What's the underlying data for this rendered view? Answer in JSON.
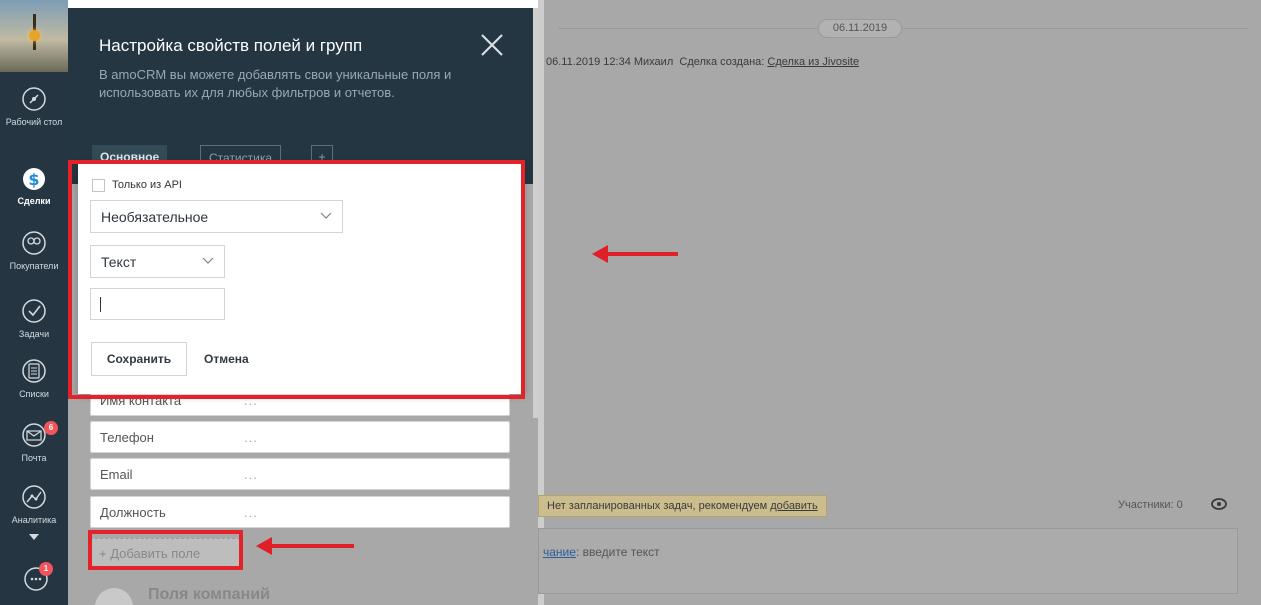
{
  "nav": {
    "items": [
      {
        "label": "Рабочий стол",
        "icon": "dashboard-icon"
      },
      {
        "label": "Сделки",
        "icon": "deals-icon"
      },
      {
        "label": "Покупатели",
        "icon": "customers-icon"
      },
      {
        "label": "Задачи",
        "icon": "tasks-icon"
      },
      {
        "label": "Списки",
        "icon": "lists-icon"
      },
      {
        "label": "Почта",
        "icon": "mail-icon",
        "badge": "6"
      },
      {
        "label": "Аналитика",
        "icon": "analytics-icon"
      }
    ],
    "chat_badge": "1",
    "active_color": "#ffffff",
    "accent": "#f2545b"
  },
  "panel": {
    "title": "Настройка свойств полей и групп",
    "subtitle": "В amoCRM вы можете добавлять свои уникальные поля и использовать их для любых фильтров и отчетов.",
    "tabs": [
      {
        "label": "Основное"
      },
      {
        "label": "Статистика"
      },
      {
        "label": "+"
      }
    ],
    "fields": [
      {
        "name": "Имя контакта",
        "value": "..."
      },
      {
        "name": "Телефон",
        "value": "..."
      },
      {
        "name": "Email",
        "value": "..."
      },
      {
        "name": "Должность",
        "value": "..."
      }
    ],
    "add_field_label": "+ Добавить поле",
    "company_section": "Поля компаний"
  },
  "popup": {
    "api_only_label": "Только из API",
    "requirement_select": "Необязательное",
    "type_select": "Текст",
    "name_input_value": "",
    "save_label": "Сохранить",
    "cancel_label": "Отмена",
    "highlight_color": "#e3222a"
  },
  "feed": {
    "date_pill": "06.11.2019",
    "event_meta": "06.11.2019 12:34 Михаил",
    "event_text": "Сделка создана:",
    "event_link": "Сделка из Jivosite",
    "no_tasks_text": "Нет запланированных задач, рекомендуем",
    "no_tasks_link": "добавить",
    "participants": "Участники: 0",
    "note_link": "чание",
    "note_placeholder": ": введите текст"
  }
}
